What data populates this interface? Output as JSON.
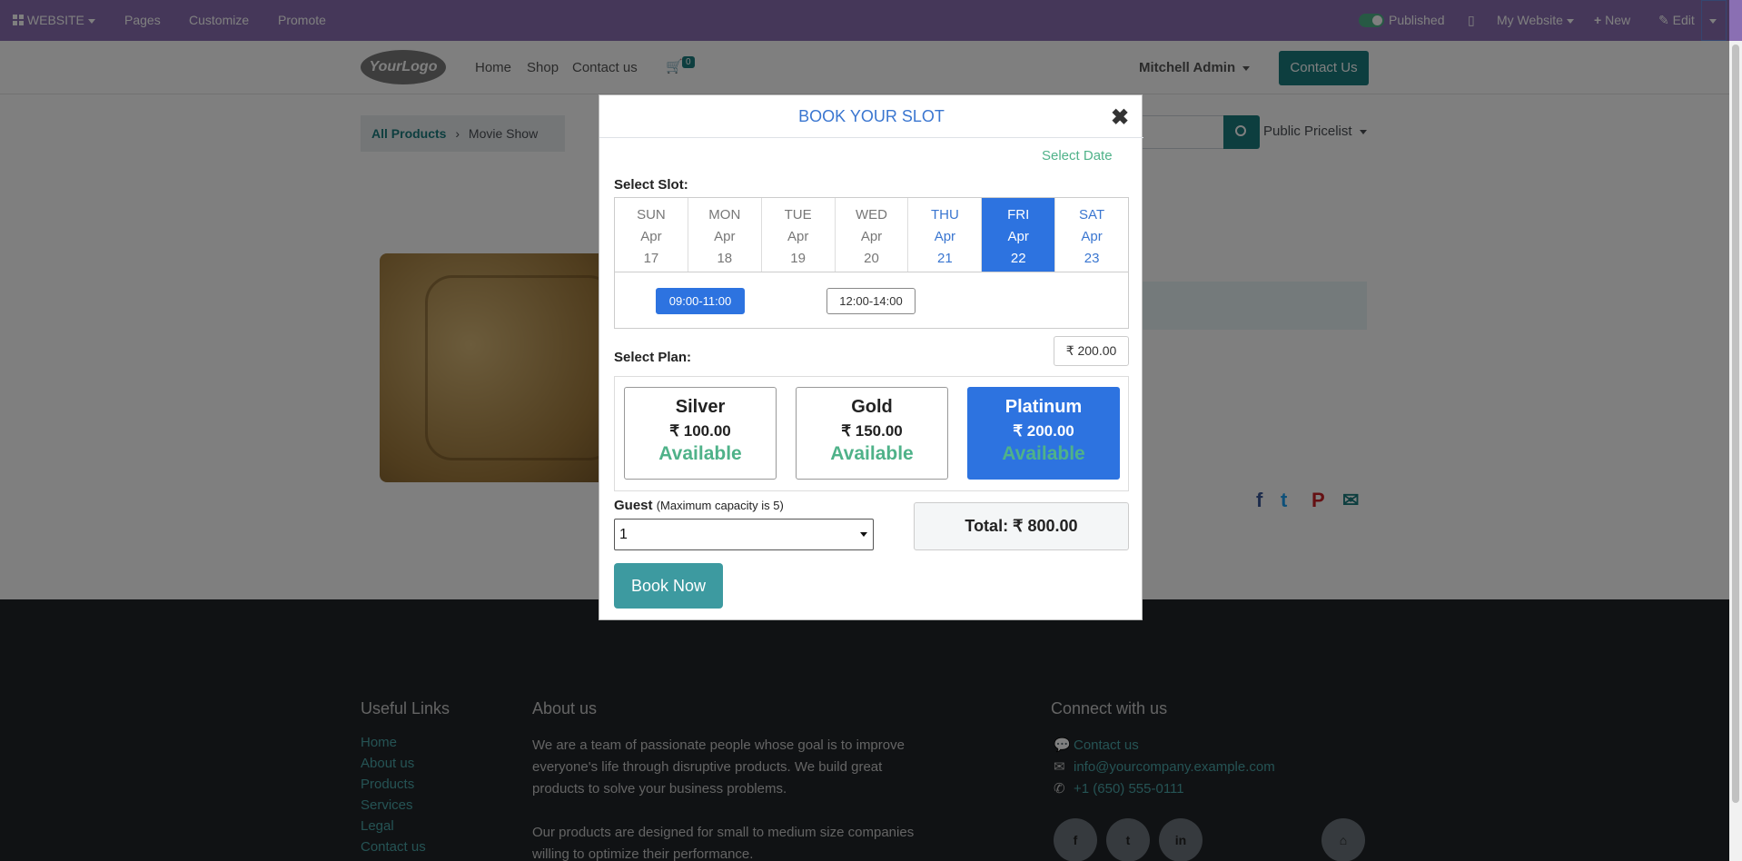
{
  "topbar": {
    "website": "WEBSITE",
    "pages": "Pages",
    "customize": "Customize",
    "promote": "Promote",
    "published": "Published",
    "my_website": "My Website",
    "new": "New",
    "edit": "Edit"
  },
  "header": {
    "logo": "YourLogo",
    "nav": [
      "Home",
      "Shop",
      "Contact us"
    ],
    "cart_count": "0",
    "user": "Mitchell Admin",
    "contact_button": "Contact Us"
  },
  "breadcrumb": {
    "link": "All Products",
    "current": "Movie Show"
  },
  "pricelist": "Public Pricelist",
  "modal": {
    "title": "BOOK YOUR SLOT",
    "select_date": "Select Date",
    "select_slot_label": "Select Slot:",
    "days": [
      {
        "dow": "SUN",
        "month": "Apr",
        "day": "17",
        "state": "past"
      },
      {
        "dow": "MON",
        "month": "Apr",
        "day": "18",
        "state": "past"
      },
      {
        "dow": "TUE",
        "month": "Apr",
        "day": "19",
        "state": "past"
      },
      {
        "dow": "WED",
        "month": "Apr",
        "day": "20",
        "state": "past"
      },
      {
        "dow": "THU",
        "month": "Apr",
        "day": "21",
        "state": "future"
      },
      {
        "dow": "FRI",
        "month": "Apr",
        "day": "22",
        "state": "selected"
      },
      {
        "dow": "SAT",
        "month": "Apr",
        "day": "23",
        "state": "future"
      }
    ],
    "slots": [
      {
        "label": "09:00-11:00",
        "selected": true
      },
      {
        "label": "12:00-14:00",
        "selected": false
      }
    ],
    "select_plan_label": "Select Plan:",
    "plan_price": "₹ 200.00",
    "plans": [
      {
        "name": "Silver",
        "price": "₹ 100.00",
        "status": "Available",
        "selected": false
      },
      {
        "name": "Gold",
        "price": "₹ 150.00",
        "status": "Available",
        "selected": false
      },
      {
        "name": "Platinum",
        "price": "₹ 200.00",
        "status": "Available",
        "selected": true
      }
    ],
    "guest_label": "Guest",
    "guest_note": "(Maximum capacity is 5)",
    "guest_value": "1",
    "total": "Total: ₹ 800.00",
    "book_button": "Book Now"
  },
  "footer": {
    "useful_links_title": "Useful Links",
    "useful_links": [
      "Home",
      "About us",
      "Products",
      "Services",
      "Legal",
      "Contact us"
    ],
    "about_title": "About us",
    "about_p1": "We are a team of passionate people whose goal is to improve everyone's life through disruptive products. We build great products to solve your business problems.",
    "about_p2": "Our products are designed for small to medium size companies willing to optimize their performance.",
    "connect_title": "Connect with us",
    "contact": "Contact us",
    "email": "info@yourcompany.example.com",
    "phone": "+1 (650) 555-0111"
  },
  "colors": {
    "topbar": "#8a6fb3",
    "accent": "#1a7c7f",
    "selected": "#2d73e0",
    "available": "#4fb289"
  }
}
